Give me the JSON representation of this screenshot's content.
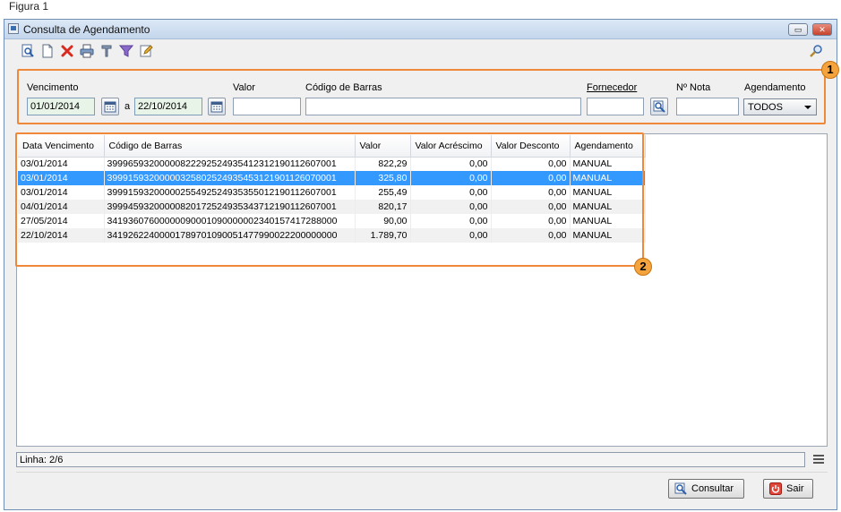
{
  "caption": "Figura 1",
  "window": {
    "title": "Consulta de Agendamento",
    "minimize": "▭",
    "close": "✕"
  },
  "toolbar": {
    "tools": [
      "search-doc-icon",
      "new-doc-icon",
      "delete-icon",
      "print-icon",
      "tools-icon",
      "filter-icon",
      "edit-icon"
    ],
    "right_tool": "zoom-icon"
  },
  "callouts": {
    "one": "1",
    "two": "2"
  },
  "filters": {
    "vencimento_label": "Vencimento",
    "date_from": "01/01/2014",
    "range_sep": "a",
    "date_to": "22/10/2014",
    "valor_label": "Valor",
    "valor_value": "",
    "codigo_label": "Código de Barras",
    "codigo_value": "",
    "fornecedor_label": "Fornecedor",
    "fornecedor_value": "",
    "nota_label": "Nº Nota",
    "nota_value": "",
    "agendamento_label": "Agendamento",
    "agendamento_selected": "TODOS"
  },
  "grid": {
    "columns": [
      "Data Vencimento",
      "Código de Barras",
      "Valor",
      "Valor Acréscimo",
      "Valor Desconto",
      "Agendamento"
    ],
    "rows": [
      [
        "03/01/2014",
        "39996593200000822292524935412312190112607001",
        "822,29",
        "0,00",
        "0,00",
        "MANUAL"
      ],
      [
        "03/01/2014",
        "39991593200000325802524935453121901126070001",
        "325,80",
        "0,00",
        "0,00",
        "MANUAL"
      ],
      [
        "03/01/2014",
        "39991593200000255492524935355012190112607001",
        "255,49",
        "0,00",
        "0,00",
        "MANUAL"
      ],
      [
        "04/01/2014",
        "39994593200000820172524935343712190112607001",
        "820,17",
        "0,00",
        "0,00",
        "MANUAL"
      ],
      [
        "27/05/2014",
        "34193607600000090001090000002340157417288000",
        "90,00",
        "0,00",
        "0,00",
        "MANUAL"
      ],
      [
        "22/10/2014",
        "34192622400001789701090051477990022200000000",
        "1.789,70",
        "0,00",
        "0,00",
        "MANUAL"
      ]
    ],
    "selected_row": 1
  },
  "status": {
    "line": "Linha: 2/6"
  },
  "buttons": {
    "consultar": "Consultar",
    "sair": "Sair"
  }
}
